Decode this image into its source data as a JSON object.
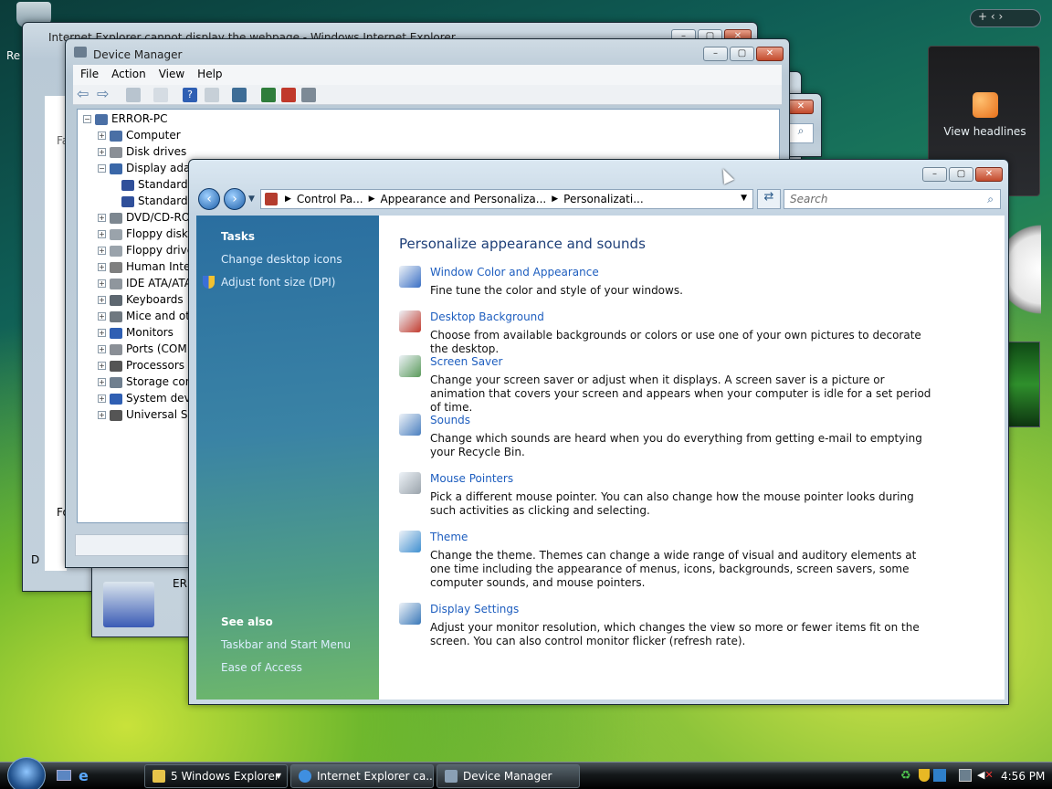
{
  "desktop": {
    "recycle_label": "Re",
    "gadget_headlines": "View headlines"
  },
  "ie_window": {
    "title": "Internet Explorer cannot display the webpage - Windows Internet Explorer",
    "left_fragments": [
      "Fa",
      "Fo",
      "D"
    ]
  },
  "device_manager": {
    "title": "Device Manager",
    "menu": [
      "File",
      "Action",
      "View",
      "Help"
    ],
    "tree_root": "ERROR-PC",
    "nodes": [
      {
        "label": "Computer",
        "indent": 1
      },
      {
        "label": "Disk drives",
        "indent": 1
      },
      {
        "label": "Display adapters",
        "indent": 1
      },
      {
        "label": "Standard VGA Graphics Adapter",
        "indent": 2
      },
      {
        "label": "Standard VGA Graphics Adapter",
        "indent": 2
      },
      {
        "label": "DVD/CD-ROM drives",
        "indent": 1
      },
      {
        "label": "Floppy disk controllers",
        "indent": 1
      },
      {
        "label": "Floppy drive controllers",
        "indent": 1
      },
      {
        "label": "Human Interface Devices",
        "indent": 1
      },
      {
        "label": "IDE ATA/ATAPI controllers",
        "indent": 1
      },
      {
        "label": "Keyboards",
        "indent": 1
      },
      {
        "label": "Mice and other pointing devices",
        "indent": 1
      },
      {
        "label": "Monitors",
        "indent": 1
      },
      {
        "label": "Ports (COM & LPT)",
        "indent": 1
      },
      {
        "label": "Processors",
        "indent": 1
      },
      {
        "label": "Storage controllers",
        "indent": 1
      },
      {
        "label": "System devices",
        "indent": 1
      },
      {
        "label": "Universal Serial Bus controllers",
        "indent": 1
      }
    ],
    "back_panel_label": "ERI"
  },
  "personalization": {
    "breadcrumb": [
      "Control Pa...",
      "Appearance and Personaliza...",
      "Personalizati..."
    ],
    "search_placeholder": "Search",
    "tasks_header": "Tasks",
    "tasks": [
      "Change desktop icons",
      "Adjust font size (DPI)"
    ],
    "see_also_header": "See also",
    "see_also": [
      "Taskbar and Start Menu",
      "Ease of Access"
    ],
    "heading": "Personalize appearance and sounds",
    "items": [
      {
        "title": "Window Color and Appearance",
        "desc": "Fine tune the color and style of your windows.",
        "color": "#3a6fc4"
      },
      {
        "title": "Desktop Background",
        "desc": "Choose from available backgrounds or colors or use one of your own pictures to decorate the desktop.",
        "color": "#c23b2e"
      },
      {
        "title": "Screen Saver",
        "desc": "Change your screen saver or adjust when it displays. A screen saver is a picture or animation that covers your screen and appears when your computer is idle for a set period of time.",
        "color": "#5a9a5a"
      },
      {
        "title": "Sounds",
        "desc": "Change which sounds are heard when you do everything from getting e-mail to emptying your Recycle Bin.",
        "color": "#4a7fbf"
      },
      {
        "title": "Mouse Pointers",
        "desc": "Pick a different mouse pointer. You can also change how the mouse pointer looks during such activities as clicking and selecting.",
        "color": "#9aa3ab"
      },
      {
        "title": "Theme",
        "desc": "Change the theme. Themes can change a wide range of visual and auditory elements at one time including the appearance of menus, icons, backgrounds, screen savers, some computer sounds, and mouse pointers.",
        "color": "#3f8fd0"
      },
      {
        "title": "Display Settings",
        "desc": "Adjust your monitor resolution, which changes the view so more or fewer items fit on the screen. You can also control monitor flicker (refresh rate).",
        "color": "#3a78b8"
      }
    ]
  },
  "taskbar": {
    "buttons": [
      "5 Windows Explorer",
      "Internet Explorer ca...",
      "Device Manager"
    ],
    "clock": "4:56 PM"
  }
}
